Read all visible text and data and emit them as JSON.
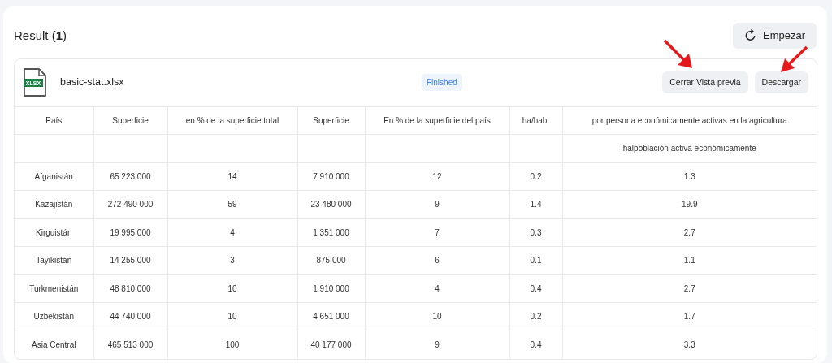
{
  "title": "Result (**1**)",
  "start_button": {
    "label": "Empezar"
  },
  "file": {
    "name": "basic-stat.xlsx",
    "icon_label": "XLSX",
    "status": "Finished"
  },
  "actions": [
    "Cerrar Vista previa",
    "Descargar"
  ],
  "table": {
    "columns": [
      {
        "label": "País"
      },
      {
        "label": "Superficie"
      },
      {
        "label": "en % de la superficie total"
      },
      {
        "label": "Superficie"
      },
      {
        "label": "En % de la superficie del país"
      },
      {
        "label": "ha/hab."
      },
      {
        "label": "por persona económicamente activas en la agricultura",
        "sublabel": "halpoblación activa económicamente"
      }
    ],
    "rows": [
      [
        "Afganistán",
        "65 223 000",
        "14",
        "7 910 000",
        "12",
        "0.2",
        "1.3"
      ],
      [
        "Kazajistán",
        "272 490 000",
        "59",
        "23 480 000",
        "9",
        "1.4",
        "19.9"
      ],
      [
        "Kirguistán",
        "19 995 000",
        "4",
        "1 351 000",
        "7",
        "0.3",
        "2.7"
      ],
      [
        "Tayikistán",
        "14 255 000",
        "3",
        "875 000",
        "6",
        "0.1",
        "1.1"
      ],
      [
        "Turkmenistán",
        "48 810 000",
        "10",
        "1 910 000",
        "4",
        "0.4",
        "2.7"
      ],
      [
        "Uzbekistán",
        "44 740 000",
        "10",
        "4 651 000",
        "10",
        "0.2",
        "1.7"
      ],
      [
        "Asia Central",
        "465 513 000",
        "100",
        "40 177 000",
        "9",
        "0.4",
        "3.3"
      ]
    ]
  }
}
